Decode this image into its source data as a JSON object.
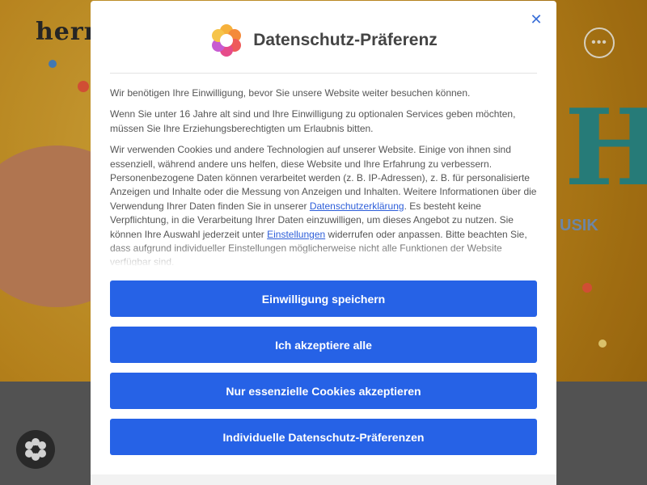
{
  "background": {
    "logo_text": "herr",
    "big_letter": "H",
    "subtitle": "USIK",
    "menu_icon": "ellipsis-icon",
    "fab_icon": "flower-icon"
  },
  "modal": {
    "title": "Datenschutz-Präferenz",
    "close_icon": "close-icon",
    "close_glyph": "✕",
    "brand_icon": "flower-logo-icon",
    "intro": "Wir benötigen Ihre Einwilligung, bevor Sie unsere Website weiter besuchen können.",
    "minor_notice": "Wenn Sie unter 16 Jahre alt sind und Ihre Einwilligung zu optionalen Services geben möchten, müssen Sie Ihre Erziehungsberechtigten um Erlaubnis bitten.",
    "details": {
      "part1": "Wir verwenden Cookies und andere Technologien auf unserer Website. Einige von ihnen sind essenziell, während andere uns helfen, diese Website und Ihre Erfahrung zu verbessern. Personenbezogene Daten können verarbeitet werden (z. B. IP-Adressen), z. B. für personalisierte Anzeigen und Inhalte oder die Messung von Anzeigen und Inhalten. Weitere Informationen über die Verwendung Ihrer Daten finden Sie in unserer ",
      "privacy_link": "Datenschutzerklärung",
      "part2": ". Es besteht keine Verpflichtung, in die Verarbeitung Ihrer Daten einzuwilligen, um dieses Angebot zu nutzen. Sie können Ihre Auswahl jederzeit unter ",
      "settings_link": "Einstellungen",
      "part3": " widerrufen oder anpassen. Bitte beachten Sie, dass aufgrund individueller Einstellungen möglicherweise nicht alle Funktionen der Website verfügbar sind."
    },
    "buttons": {
      "save": "Einwilligung speichern",
      "accept_all": "Ich akzeptiere alle",
      "essential_only": "Nur essenzielle Cookies akzeptieren",
      "individual": "Individuelle Datenschutz-Präferenzen"
    }
  },
  "colors": {
    "accent": "#2662e6",
    "link": "#2d5ed9",
    "title": "#444444",
    "body_text": "#555555"
  }
}
